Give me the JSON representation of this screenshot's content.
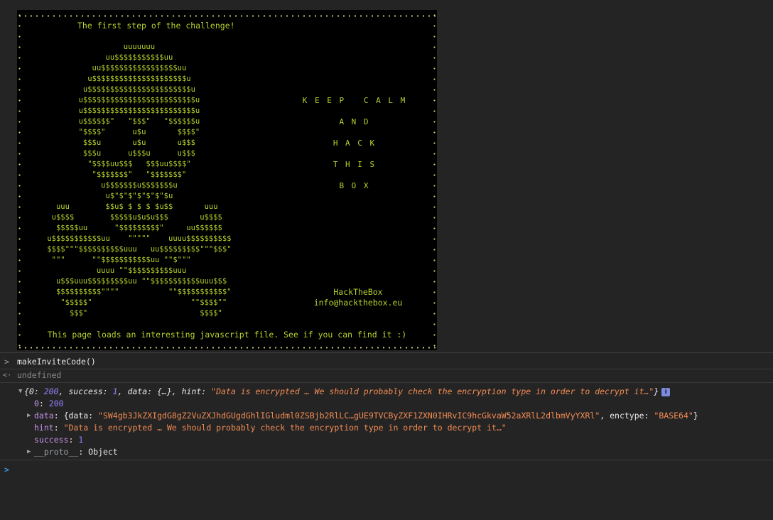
{
  "terminal": {
    "heading": "The first step of the challenge!",
    "skull_ascii": "                  uuuuuuu\n              uu$$$$$$$$$$$uu\n           uu$$$$$$$$$$$$$$$$$uu\n          u$$$$$$$$$$$$$$$$$$$$$u\n         u$$$$$$$$$$$$$$$$$$$$$$$u\n        u$$$$$$$$$$$$$$$$$$$$$$$$$u\n        u$$$$$$$$$$$$$$$$$$$$$$$$$u\n        u$$$$$$\"   \"$$$\"   \"$$$$$$u\n        \"$$$$\"      u$u       $$$$\"\n         $$$u       u$u       u$$$\n         $$$u      u$$$u      u$$$\n          \"$$$$uu$$$   $$$uu$$$$\"\n           \"$$$$$$$\"   \"$$$$$$$\"\n             u$$$$$$$u$$$$$$$u\n              u$\"$\"$\"$\"$\"$\"$u\n   uuu        $$u$ $ $ $ $u$$       uuu\n  u$$$$        $$$$$u$u$u$$$       u$$$$\n   $$$$$uu      \"$$$$$$$$$\"     uu$$$$$$\n u$$$$$$$$$$$uu    \"\"\"\"\"    uuuu$$$$$$$$$$\n $$$$\"\"\"$$$$$$$$$$uuu   uu$$$$$$$$$\"\"\"$$$\"\n  \"\"\"      \"\"$$$$$$$$$$$uu \"\"$\"\"\"\n            uuuu \"\"$$$$$$$$$$uuu\n   u$$$uuu$$$$$$$$$uu \"\"$$$$$$$$$$$uuu$$$\n   $$$$$$$$$$\"\"\"\"           \"\"$$$$$$$$$$$\"\n    \"$$$$$\"                      \"\"$$$$\"\"\n      $$$\"                         $$$$\"",
    "keep_calm": [
      "K E E P   C A L M",
      "A N D",
      "H A C K",
      "T H I S",
      "B O X"
    ],
    "brand": "HackTheBox",
    "email": "info@hackthebox.eu",
    "footer": "This page loads an interesting javascript file. See if you can find it :)"
  },
  "console": {
    "prompt_glyph": ">",
    "result_glyph": "<·",
    "command": "makeInviteCode()",
    "return_value": "undefined",
    "object_summary": {
      "open": "{0: ",
      "zero_val": "200",
      "success_part": ", success: ",
      "success_val": "1",
      "data_part": ", data: {…}, hint: ",
      "hint_val": "\"Data is encrypted … We should probably check the encryption type in order to decrypt it…\"",
      "close": "}",
      "info_badge": "i"
    },
    "props": {
      "zero_key": "0",
      "zero_val": "200",
      "data_key": "data",
      "data_open": "{data: ",
      "data_data_val": "\"SW4gb3JkZXIgdG8gZ2VuZXJhdGUgdGhlIGludml0ZSBjb2RlLC…gUE9TVCByZXF1ZXN0IHRvIC9hcGkvaW52aXRlL2dlbmVyYXRl\"",
      "data_mid": ", enctype: ",
      "data_enctype_val": "\"BASE64\"",
      "data_close": "}",
      "hint_key": "hint",
      "hint_val": "\"Data is encrypted … We should probably check the encryption type in order to decrypt it…\"",
      "success_key": "success",
      "success_val": "1",
      "proto_key": "__proto__",
      "proto_val": "Object"
    },
    "input_prompt": ">"
  },
  "colors": {
    "terminal_green": "#b6d12d",
    "terminal_bg": "#000000",
    "console_bg": "#242424",
    "string": "#f28b54",
    "number": "#9980ff",
    "key": "#c792ea",
    "prompt_blue": "#3c9bea"
  }
}
